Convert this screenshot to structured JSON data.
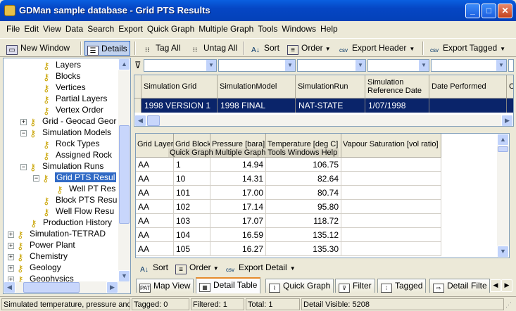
{
  "window": {
    "title": "GDMan sample database - Grid PTS Results"
  },
  "menu": [
    "File",
    "Edit",
    "View",
    "Data",
    "Search",
    "Export",
    "Quick Graph",
    "Multiple Graph",
    "Tools",
    "Windows",
    "Help"
  ],
  "toolbar": {
    "new_window": "New Window",
    "details": "Details",
    "tag_all": "Tag All",
    "untag_all": "Untag All",
    "sort": "Sort",
    "order": "Order",
    "export_header": "Export Header",
    "export_tagged": "Export Tagged"
  },
  "tree": [
    "Layers",
    "Blocks",
    "Vertices",
    "Partial Layers",
    "Vertex Order",
    "Grid - Geocad Geor",
    "Simulation Models",
    "Rock Types",
    "Assigned Rock",
    "Simulation Runs",
    "Grid PTS Resul",
    "Well PT Res",
    "Block PTS Resu",
    "Well Flow Resu",
    "Production History",
    "Simulation-TETRAD",
    "Power Plant",
    "Chemistry",
    "Geology",
    "Geophysics"
  ],
  "grid1": {
    "headers": [
      "Simulation Grid",
      "SimulationModel",
      "SimulationRun",
      "Simulation Reference Date",
      "Date Performed",
      "C"
    ],
    "row": [
      "1998 VERSION 1",
      "1998 FINAL",
      "NAT-STATE",
      "1/07/1998",
      "",
      ""
    ]
  },
  "grid2": {
    "headers": [
      "Grid Layer",
      "Grid Block",
      "Pressure [bara]",
      "Temperature [deg C]",
      "Vapour Saturation [vol ratio]"
    ],
    "ghost_menu": "Quick Graph  Multiple Graph  Tools  Windows  Help",
    "rows": [
      [
        "AA",
        "1",
        "14.94",
        "106.75",
        ""
      ],
      [
        "AA",
        "10",
        "14.31",
        "82.64",
        ""
      ],
      [
        "AA",
        "101",
        "17.00",
        "80.74",
        ""
      ],
      [
        "AA",
        "102",
        "17.14",
        "95.80",
        ""
      ],
      [
        "AA",
        "103",
        "17.07",
        "118.72",
        ""
      ],
      [
        "AA",
        "104",
        "16.59",
        "135.12",
        ""
      ],
      [
        "AA",
        "105",
        "16.27",
        "135.30",
        ""
      ]
    ]
  },
  "bottom_toolbar": {
    "sort": "Sort",
    "order": "Order",
    "export_detail": "Export Detail"
  },
  "tabs": [
    "Map View",
    "Detail Table",
    "Quick Graph",
    "Filter",
    "Tagged",
    "Detail Filte"
  ],
  "status": {
    "description": "Simulated temperature, pressure and",
    "tagged": "Tagged: 0",
    "filtered": "Filtered: 1",
    "total": "Total: 1",
    "detail_visible": "Detail Visible: 5208"
  }
}
